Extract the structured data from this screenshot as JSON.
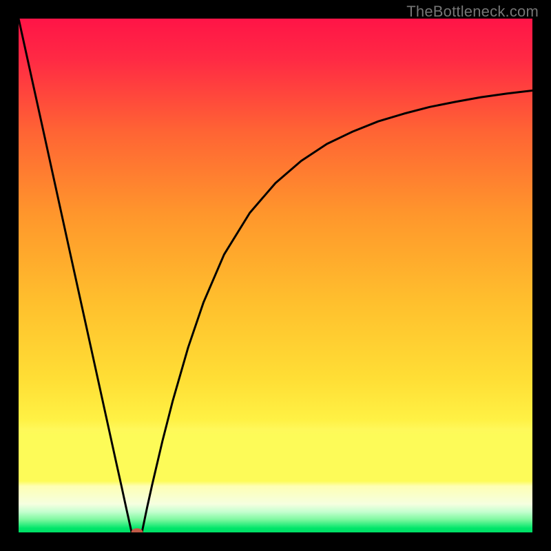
{
  "watermark": "TheBottleneck.com",
  "chart_data": {
    "type": "line",
    "title": "",
    "xlabel": "",
    "ylabel": "",
    "xlim": [
      0,
      100
    ],
    "ylim": [
      0,
      100
    ],
    "axes_visible": false,
    "background_gradient": {
      "top": "#ff1447",
      "mid_upper": "#ff8b2b",
      "mid": "#ffd42d",
      "mid_lower": "#fdfb58",
      "band_pale": "#fbffe4",
      "bottom": "#00e66a"
    },
    "series": [
      {
        "name": "left-branch",
        "type": "line",
        "color": "#000000",
        "x": [
          0,
          5,
          10,
          15,
          17,
          19,
          20,
          21,
          22
        ],
        "y": [
          100,
          77.3,
          54.5,
          31.8,
          22.7,
          13.6,
          9.1,
          4.5,
          0
        ]
      },
      {
        "name": "right-branch",
        "type": "line",
        "color": "#000000",
        "x": [
          24,
          25,
          26,
          28,
          30,
          33,
          36,
          40,
          45,
          50,
          55,
          60,
          65,
          70,
          75,
          80,
          85,
          90,
          95,
          100
        ],
        "y": [
          0,
          4.8,
          9.3,
          17.8,
          25.6,
          36.0,
          44.8,
          54.1,
          62.2,
          68.0,
          72.3,
          75.6,
          78.0,
          80.0,
          81.5,
          82.8,
          83.8,
          84.7,
          85.4,
          86.0
        ]
      }
    ],
    "marker": {
      "x": 23,
      "y": 0,
      "color": "#c15b48",
      "shape": "ellipse"
    }
  }
}
